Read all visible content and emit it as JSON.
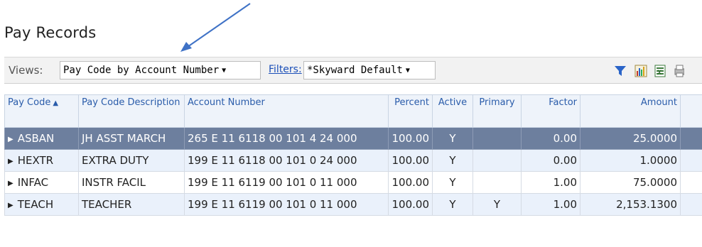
{
  "page": {
    "title": "Pay Records"
  },
  "toolbar": {
    "views_label": "Views:",
    "view_selected": "Pay Code by Account Number",
    "filters_label": "Filters:",
    "filter_selected": "*Skyward Default",
    "icons": [
      "filter-icon",
      "chart-icon",
      "excel-export-icon",
      "print-icon"
    ]
  },
  "table": {
    "headers": {
      "pay_code": "Pay Code",
      "pay_code_desc": "Pay Code Description",
      "account_number": "Account Number",
      "percent": "Percent",
      "active": "Active",
      "primary": "Primary",
      "factor": "Factor",
      "amount": "Amount"
    },
    "rows": [
      {
        "code": "ASBAN",
        "desc": "JH ASST MARCH",
        "account": "265 E 11 6118 00 101 4 24 000",
        "percent": "100.00",
        "active": "Y",
        "primary": "",
        "factor": "0.00",
        "amount": "25.0000"
      },
      {
        "code": "HEXTR",
        "desc": "EXTRA DUTY",
        "account": "199 E 11 6118 00 101 0 24 000",
        "percent": "100.00",
        "active": "Y",
        "primary": "",
        "factor": "0.00",
        "amount": "1.0000"
      },
      {
        "code": "INFAC",
        "desc": "INSTR FACIL",
        "account": "199 E 11 6119 00 101 0 11 000",
        "percent": "100.00",
        "active": "Y",
        "primary": "",
        "factor": "1.00",
        "amount": "75.0000"
      },
      {
        "code": "TEACH",
        "desc": "TEACHER",
        "account": "199 E 11 6119 00 101 0 11 000",
        "percent": "100.00",
        "active": "Y",
        "primary": "Y",
        "factor": "1.00",
        "amount": "2,153.1300"
      }
    ]
  },
  "colors": {
    "header_text": "#2a5caa",
    "selected_row": "#6d7f9e",
    "alt_row": "#eaf1fb",
    "arrow": "#3f72c6"
  }
}
